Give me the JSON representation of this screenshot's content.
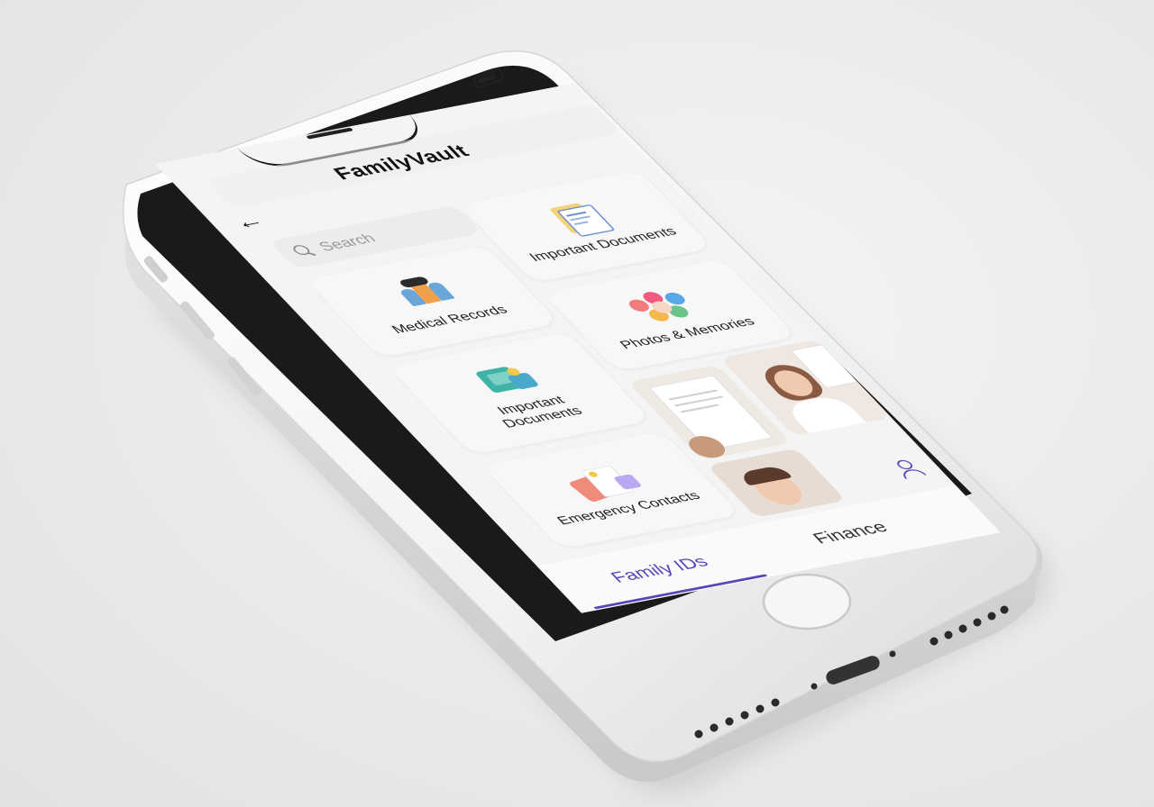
{
  "app": {
    "title": "FamilyVault",
    "back_label": "←"
  },
  "search": {
    "placeholder": "Search"
  },
  "categories": [
    {
      "label": "Medical Records",
      "icon": "family-icon"
    },
    {
      "label": "Important Documents",
      "icon": "documents-icon"
    },
    {
      "label": "Important Documents",
      "icon": "folder-icon"
    },
    {
      "label": "Photos & Memories",
      "icon": "photos-icon"
    },
    {
      "label": "Emergency Contacts",
      "icon": "contacts-icon"
    }
  ],
  "tabs": {
    "family_ids": "Family IDs",
    "finance": "Finance"
  },
  "colors": {
    "accent": "#5b44b8",
    "card": "#f7f7f7",
    "background": "#ececec"
  }
}
